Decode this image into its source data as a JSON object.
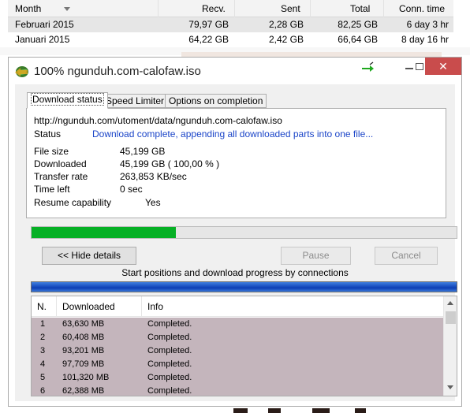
{
  "stats_table": {
    "columns": [
      "Month",
      "Recv.",
      "Sent",
      "Total",
      "Conn. time"
    ],
    "rows": [
      {
        "month": "Februari 2015",
        "recv": "79,97 GB",
        "sent": "2,28 GB",
        "total": "82,25 GB",
        "conn_time": "6 day 3 hr"
      },
      {
        "month": "Januari 2015",
        "recv": "64,22 GB",
        "sent": "2,42 GB",
        "total": "66,64 GB",
        "conn_time": "8 day 16 hr"
      }
    ]
  },
  "dialog": {
    "title": "100% ngunduh.com-calofaw.iso",
    "close_glyph": "✕",
    "tabs": [
      "Download status",
      "Speed Limiter",
      "Options on completion"
    ],
    "url": "http://ngunduh.com/utoment/data/ngunduh.com-calofaw.iso",
    "status_label": "Status",
    "status_value": "Download complete, appending all downloaded parts into one file...",
    "file_size_label": "File size",
    "file_size_value": "45,199  GB",
    "downloaded_label": "Downloaded",
    "downloaded_value": "45,199  GB  ( 100,00 % )",
    "transfer_rate_label": "Transfer rate",
    "transfer_rate_value": "263,853  KB/sec",
    "time_left_label": "Time left",
    "time_left_value": "0 sec",
    "resume_label": "Resume capability",
    "resume_value": "Yes",
    "progress_fraction": 0.34,
    "hide_details_label": "<< Hide details",
    "pause_label": "Pause",
    "cancel_label": "Cancel",
    "connections_caption": "Start positions and download progress by connections",
    "list_columns": [
      "N.",
      "Downloaded",
      "Info"
    ],
    "connections": [
      {
        "n": "1",
        "downloaded": "63,630  MB",
        "info": "Completed."
      },
      {
        "n": "2",
        "downloaded": "60,408  MB",
        "info": "Completed."
      },
      {
        "n": "3",
        "downloaded": "93,201  MB",
        "info": "Completed."
      },
      {
        "n": "4",
        "downloaded": "97,709  MB",
        "info": "Completed."
      },
      {
        "n": "5",
        "downloaded": "101,320  MB",
        "info": "Completed."
      },
      {
        "n": "6",
        "downloaded": "62,388  MB",
        "info": "Completed."
      }
    ]
  },
  "colors": {
    "progress_green": "#06b025",
    "close_red": "#c94c4c",
    "status_blue": "#1a44c8",
    "row_highlight": "#c4b5bc"
  },
  "icons": {
    "app": "idm-globe-icon",
    "green_arrow": "green-arrow-icon",
    "sort": "sort-descending-icon"
  }
}
